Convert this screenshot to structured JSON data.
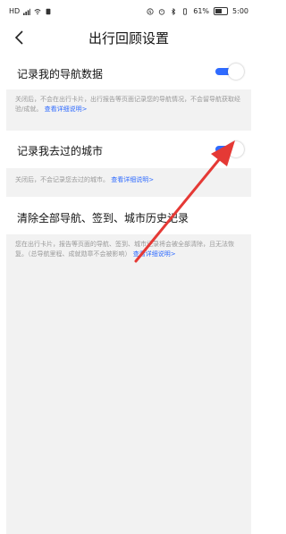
{
  "status_bar": {
    "left_text": "HD",
    "battery": "61%",
    "time": "5:00"
  },
  "header": {
    "title": "出行回顾设置"
  },
  "settings": [
    {
      "label": "记录我的导航数据",
      "enabled": true,
      "hint": "关闭后，不会在出行卡片，出行报告等页面记录您的导航情况，不会留导航获取经验/成就。",
      "hint_link": "查看详细说明>"
    },
    {
      "label": "记录我去过的城市",
      "enabled": true,
      "hint": "关闭后，不会记录您去过的城市。",
      "hint_link": "查看详细说明>"
    }
  ],
  "clear": {
    "label": "清除全部导航、签到、城市历史记录",
    "hint": "您在出行卡片，报告等页面的导航、签到、城市记录将会被全部清除，且无法恢复。（总导航里程、成就勋章不会被影响）",
    "hint_link": "查看详细说明>"
  },
  "colors": {
    "accent": "#2f6bff",
    "hint_bg": "#f2f2f2",
    "arrow": "#e53935"
  }
}
